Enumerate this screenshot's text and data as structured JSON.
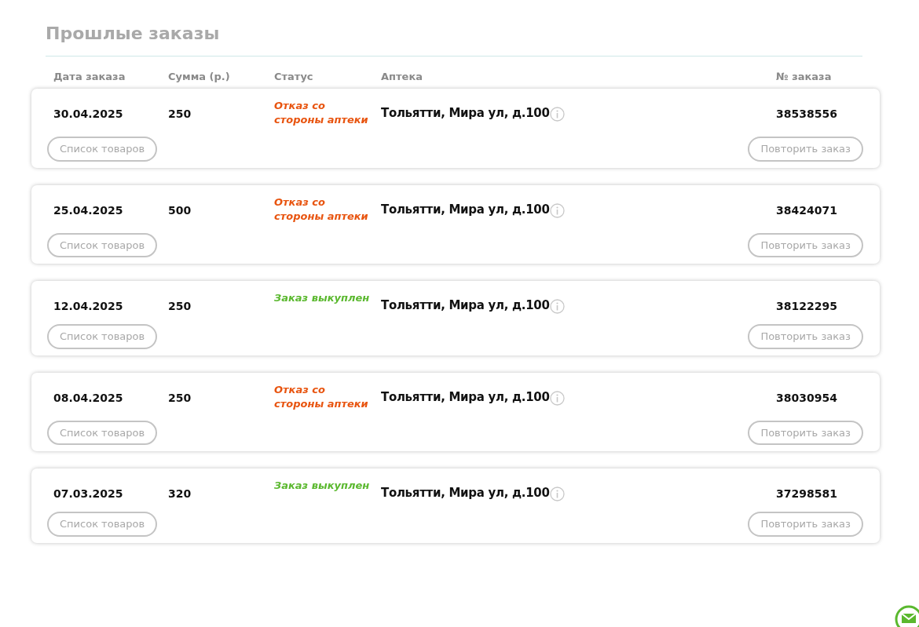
{
  "title": "Прошлые заказы",
  "columns": [
    "Дата заказа",
    "Сумма (р.)",
    "Статус",
    "Аптека",
    "№ заказа"
  ],
  "orders": [
    {
      "date": "30.04.2025",
      "sum": "250",
      "status": {
        "text": "Отказ со стороны аптеки",
        "kind": "refused"
      },
      "pharmacy": "Тольятти, Мира ул, д.100",
      "number": "38538556",
      "items_button": "Список товаров",
      "repeat_button": "Повторить заказ"
    },
    {
      "date": "25.04.2025",
      "sum": "500",
      "status": {
        "text": "Отказ со стороны аптеки",
        "kind": "refused"
      },
      "pharmacy": "Тольятти, Мира ул, д.100",
      "number": "38424071",
      "items_button": "Список товаров",
      "repeat_button": "Повторить заказ"
    },
    {
      "date": "12.04.2025",
      "sum": "250",
      "status": {
        "text": "Заказ выкуплен",
        "kind": "bought"
      },
      "pharmacy": "Тольятти, Мира ул, д.100",
      "number": "38122295",
      "items_button": "Список товаров",
      "repeat_button": "Повторить заказ"
    },
    {
      "date": "08.04.2025",
      "sum": "250",
      "status": {
        "text": "Отказ со стороны аптеки",
        "kind": "refused"
      },
      "pharmacy": "Тольятти, Мира ул, д.100",
      "number": "38030954",
      "items_button": "Список товаров",
      "repeat_button": "Повторить заказ"
    },
    {
      "date": "07.03.2025",
      "sum": "320",
      "status": {
        "text": "Заказ выкуплен",
        "kind": "bought"
      },
      "pharmacy": "Тольятти, Мира ул, д.100",
      "number": "37298581",
      "items_button": "Список товаров",
      "repeat_button": "Повторить заказ"
    }
  ]
}
